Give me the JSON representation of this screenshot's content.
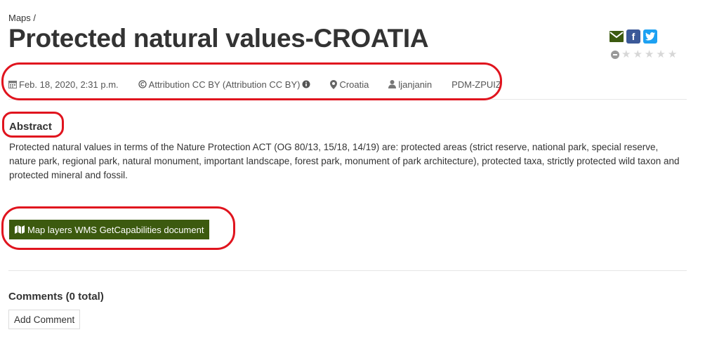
{
  "breadcrumb": {
    "parent": "Maps",
    "separator": "/"
  },
  "title": "Protected natural values-CROATIA",
  "share": {
    "icons": [
      "envelope-icon",
      "facebook-icon",
      "twitter-icon"
    ],
    "facebook_letter": "f"
  },
  "rating": {
    "stars": 5,
    "value": 0
  },
  "meta": {
    "date": "Feb. 18, 2020, 2:31 p.m.",
    "license": "Attribution CC BY (Attribution CC BY)",
    "region": "Croatia",
    "owner": "ljanjanin",
    "category": "PDM-ZPUIZ"
  },
  "abstract": {
    "heading": "Abstract",
    "text": "Protected natural values in terms of the Nature Protection ACT (OG 80/13, 15/18, 14/19) are: protected areas (strict reserve, national park, special reserve, nature park, regional park, natural monument, important landscape, forest park, monument of park architecture), protected taxa, strictly protected wild taxon and protected mineral and fossil."
  },
  "actions": {
    "wms_button_label": "Map layers WMS GetCapabilities document"
  },
  "comments": {
    "heading": "Comments (0 total)",
    "add_label": "Add Comment"
  },
  "colors": {
    "button_green": "#3c5a0f",
    "annotation_red": "#e0141e",
    "facebook_blue": "#3b5998",
    "twitter_blue": "#1da1f2",
    "email_green": "#3c5a0f"
  }
}
